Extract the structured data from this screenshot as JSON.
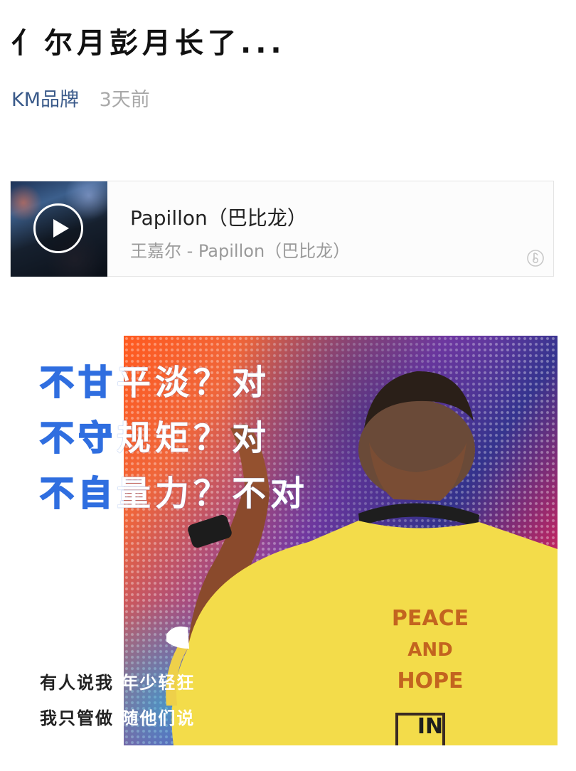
{
  "article": {
    "title": "亻尔月彭月长了...",
    "author": "KM品牌",
    "time": "3天前"
  },
  "music": {
    "title": "Papillon（巴比龙）",
    "artist": "王嘉尔 - Papillon（巴比龙）",
    "play_icon": "play-circle-icon",
    "logo_icon": "music-note-icon"
  },
  "poster": {
    "headline": [
      {
        "outline": "不甘",
        "solid": "平淡？对"
      },
      {
        "outline": "不守",
        "solid": "规矩？对"
      },
      {
        "outline": "不自",
        "solid": "量力？不对"
      }
    ],
    "caption": [
      {
        "dark": "有人说我 ",
        "light": "年少轻狂"
      },
      {
        "dark": "我只管做 ",
        "light": "随他们说"
      }
    ],
    "shirt_lines": [
      "PEACE",
      "AND",
      "HOPE",
      "IN"
    ],
    "colors": {
      "outline_blue": "#2f6ee0",
      "shirt_yellow": "#f3dc4a",
      "shirt_text": "#c3641f"
    }
  }
}
